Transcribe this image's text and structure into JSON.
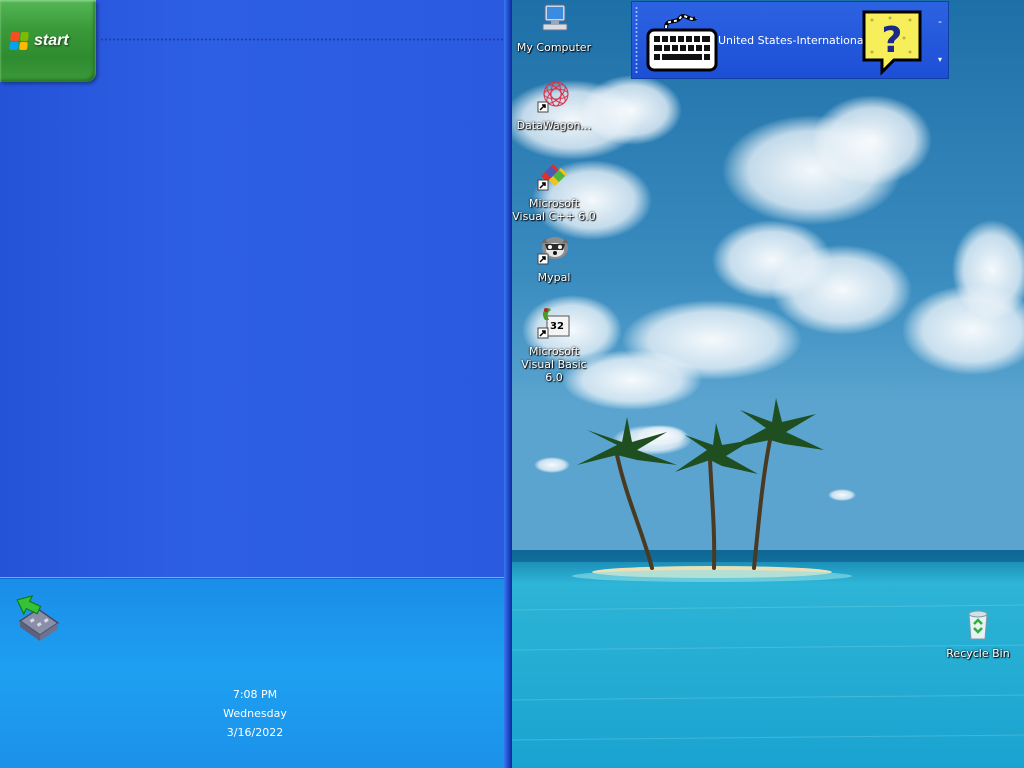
{
  "taskbar": {
    "start_label": "start",
    "clock": {
      "time": "7:08 PM",
      "day": "Wednesday",
      "date": "3/16/2022"
    }
  },
  "desktop": {
    "icons": [
      {
        "label": "My Computer",
        "icon": "my-computer-icon"
      },
      {
        "label": "DataWagon…",
        "icon": "datawagon-icon"
      },
      {
        "label": "Microsoft Visual C++ 6.0",
        "icon": "visual-cpp-icon"
      },
      {
        "label": "Mypal",
        "icon": "mypal-icon"
      },
      {
        "label": "Microsoft Visual Basic 6.0",
        "icon": "visual-basic-icon"
      },
      {
        "label": "Recycle Bin",
        "icon": "recycle-bin-icon"
      }
    ]
  },
  "language_bar": {
    "language": "United States-International",
    "minimize_glyph": "-",
    "options_glyph": "▾"
  },
  "colors": {
    "taskbar_blue": "#2a5ae0",
    "start_green": "#3a9a3a",
    "tray_blue": "#1ea0f1"
  }
}
